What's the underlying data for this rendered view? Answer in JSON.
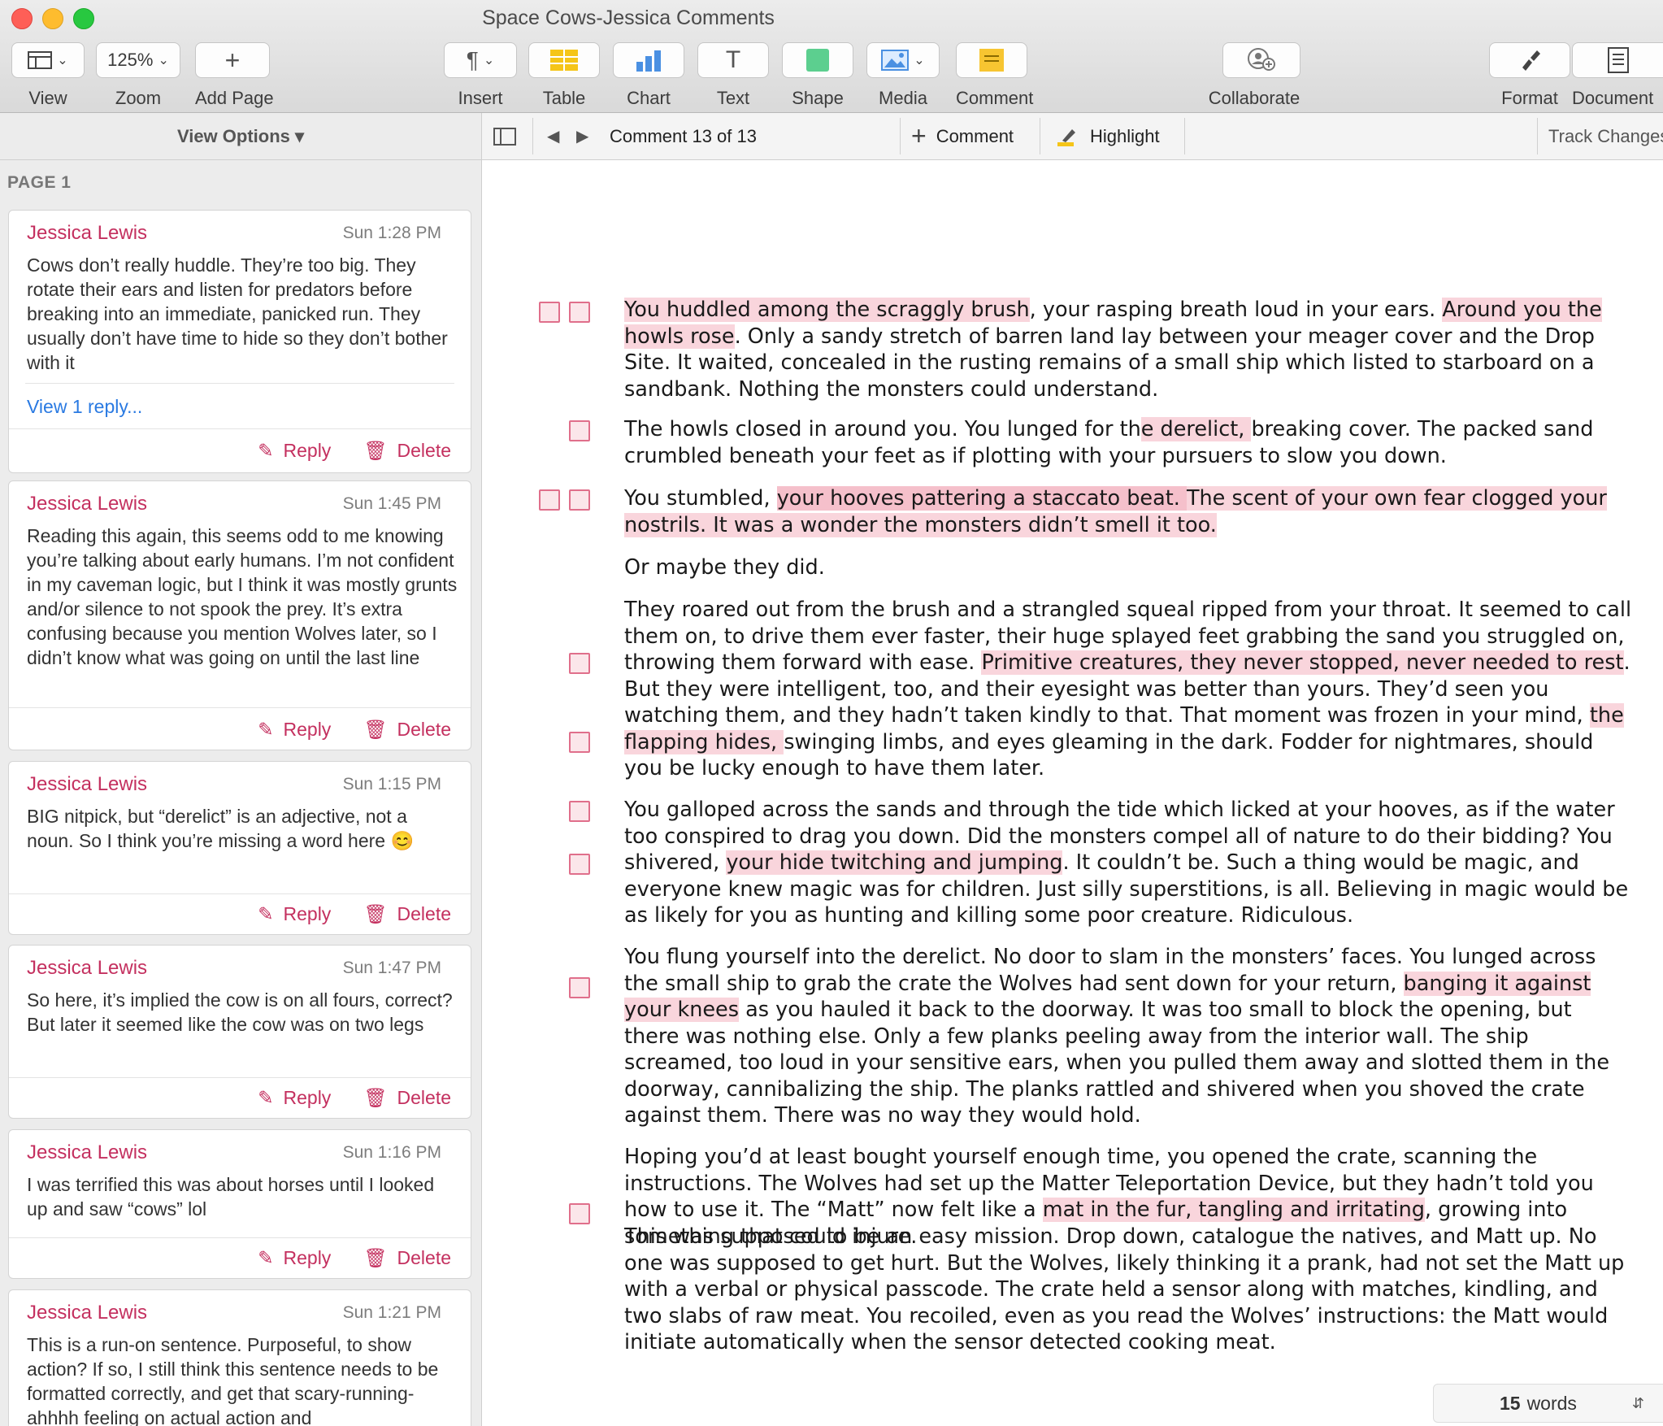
{
  "window": {
    "title": "Space Cows-Jessica Comments"
  },
  "toolbar": {
    "view": "View",
    "zoom_value": "125%",
    "zoom": "Zoom",
    "add_page": "Add Page",
    "insert": "Insert",
    "table": "Table",
    "chart": "Chart",
    "text": "Text",
    "shape": "Shape",
    "media": "Media",
    "comment": "Comment",
    "collaborate": "Collaborate",
    "format": "Format",
    "document": "Document"
  },
  "sidebar": {
    "view_options": "View Options ▾",
    "page_label": "PAGE 1",
    "reply_label": "Reply",
    "delete_label": "Delete",
    "comments": [
      {
        "author": "Jessica Lewis",
        "time": "Sun 1:28 PM",
        "text": "Cows don’t really huddle. They’re too big. They rotate their ears and listen for predators before breaking into an immediate, panicked run. They usually don’t have time to hide so they don’t bother with it",
        "replies": "View 1 reply..."
      },
      {
        "author": "Jessica Lewis",
        "time": "Sun 1:45 PM",
        "text": "Reading this again, this seems odd to me knowing you’re talking about early humans. I’m not confident in my caveman logic, but I think it was mostly grunts and/or silence to not spook the prey. It’s extra confusing because you mention Wolves later, so I didn’t know what was going on until the last line"
      },
      {
        "author": "Jessica Lewis",
        "time": "Sun 1:15 PM",
        "text": "BIG nitpick, but “derelict” is an adjective, not a noun. So I think you’re missing a word here 😊"
      },
      {
        "author": "Jessica Lewis",
        "time": "Sun 1:47 PM",
        "text": "So here, it’s implied the cow is on all fours, correct? But later it seemed like the cow was on two legs"
      },
      {
        "author": "Jessica Lewis",
        "time": "Sun 1:16 PM",
        "text": "I was terrified this was about horses until I looked up and saw “cows” lol"
      },
      {
        "author": "Jessica Lewis",
        "time": "Sun 1:21 PM",
        "text": "This is a run-on sentence. Purposeful, to show action? If so, I still think this sentence needs to be formatted correctly, and get that scary-running-ahhhh feeling on actual action and"
      }
    ]
  },
  "commentbar": {
    "nav": "Comment 13 of 13",
    "add_comment": "Comment",
    "highlight": "Highlight",
    "track_changes": "Track Changes"
  },
  "document": {
    "p1": {
      "h1": "You huddled among the scraggly brush",
      "t1": ", your rasping breath loud in your ears. ",
      "h2": "Around you the howls rose",
      "t2": ". Only a sandy stretch of barren land lay between your meager cover and the Drop Site. It waited, concealed in the rusting remains of a small ship which listed to starboard on a sandbank. Nothing the monsters could understand."
    },
    "p2": {
      "t1": "The howls closed in around you. You lunged for th",
      "h1": "e derelict, ",
      "t2": "breaking cover. The packed sand crumbled beneath your feet as if plotting with your pursuers to slow you down."
    },
    "p3": {
      "t1": "You stumbled, ",
      "h1": "your hooves pattering a staccato beat. ",
      "h2": "The scent of your own fear clogged your nostrils. It was a wonder the monsters didn’t smell it too. "
    },
    "p4": {
      "t1": "Or maybe they did."
    },
    "p5": {
      "t1": "They roared out from the brush and a strangled squeal ripped from your throat. It seemed to call them on, to drive them ever faster, their huge splayed feet grabbing the sand you struggled on, throwing them forward with ease. ",
      "h1": "Primitive creatures, they never stopped, never needed to rest",
      "t2": ". But they were intelligent, too, and their eyesight was better than yours. They’d seen you watching them, and they hadn’t taken kindly to that. That moment was frozen in your mind, ",
      "h2": "the flapping hides, ",
      "t3": "swinging limbs, and eyes gleaming in the dark. Fodder for nightmares, should you be lucky enough to have them later."
    },
    "p6": {
      "t1": "You galloped across the sands and through the tide ",
      "h1": " ",
      "t2": "which licked at your hooves, as if the water too conspired to drag you down. Did the monsters compel all of nature to do their bidding? You shivered, ",
      "h2": "your hide twitching and jumping",
      "t3": ". It couldn’t be. Such a thing would be magic, and everyone knew magic was for children. Just silly superstitions, is all. Believing in magic would be as likely for you as hunting and killing some poor creature. Ridiculous."
    },
    "p7": {
      "t1": "You flung yourself into the derelict. No door to slam in the monsters’ faces. You lunged across the small ship to grab the crate the Wolves had sent down for your return, ",
      "h1": "banging it against your knees",
      "t2": " as you hauled it back to the doorway. It was too small to block the opening, but there was nothing else. Only a few planks peeling away from the interior wall. The ship screamed, too loud in your sensitive ears, when you pulled them away and slotted them in the doorway, cannibalizing the ship. The planks rattled and shivered when you shoved the crate against them. There was no way they would hold."
    },
    "p8": {
      "t1": "Hoping you’d at least bought yourself enough time, you opened the crate, scanning the instructions. The Wolves had set up the Matter Teleportation Device, but they hadn’t told you how to use it. The “Matt” now felt like a ",
      "h1": "mat in the fur, tangling and irritating",
      "t2": ", growing into something that could injure."
    },
    "p9": {
      "t1": "This was supposed to be an easy mission. Drop down, catalogue the natives, and Matt up. No one was supposed to get hurt. But the Wolves, likely thinking it a prank, had not set the Matt up with a verbal or physical passcode. The crate held a sensor along with matches, kindling, and two slabs of raw meat. You recoiled, even as you read the Wolves’ instructions: the Matt would initiate automatically when the sensor detected cooking meat."
    }
  },
  "wordcount": {
    "value": "15",
    "label": "words"
  }
}
